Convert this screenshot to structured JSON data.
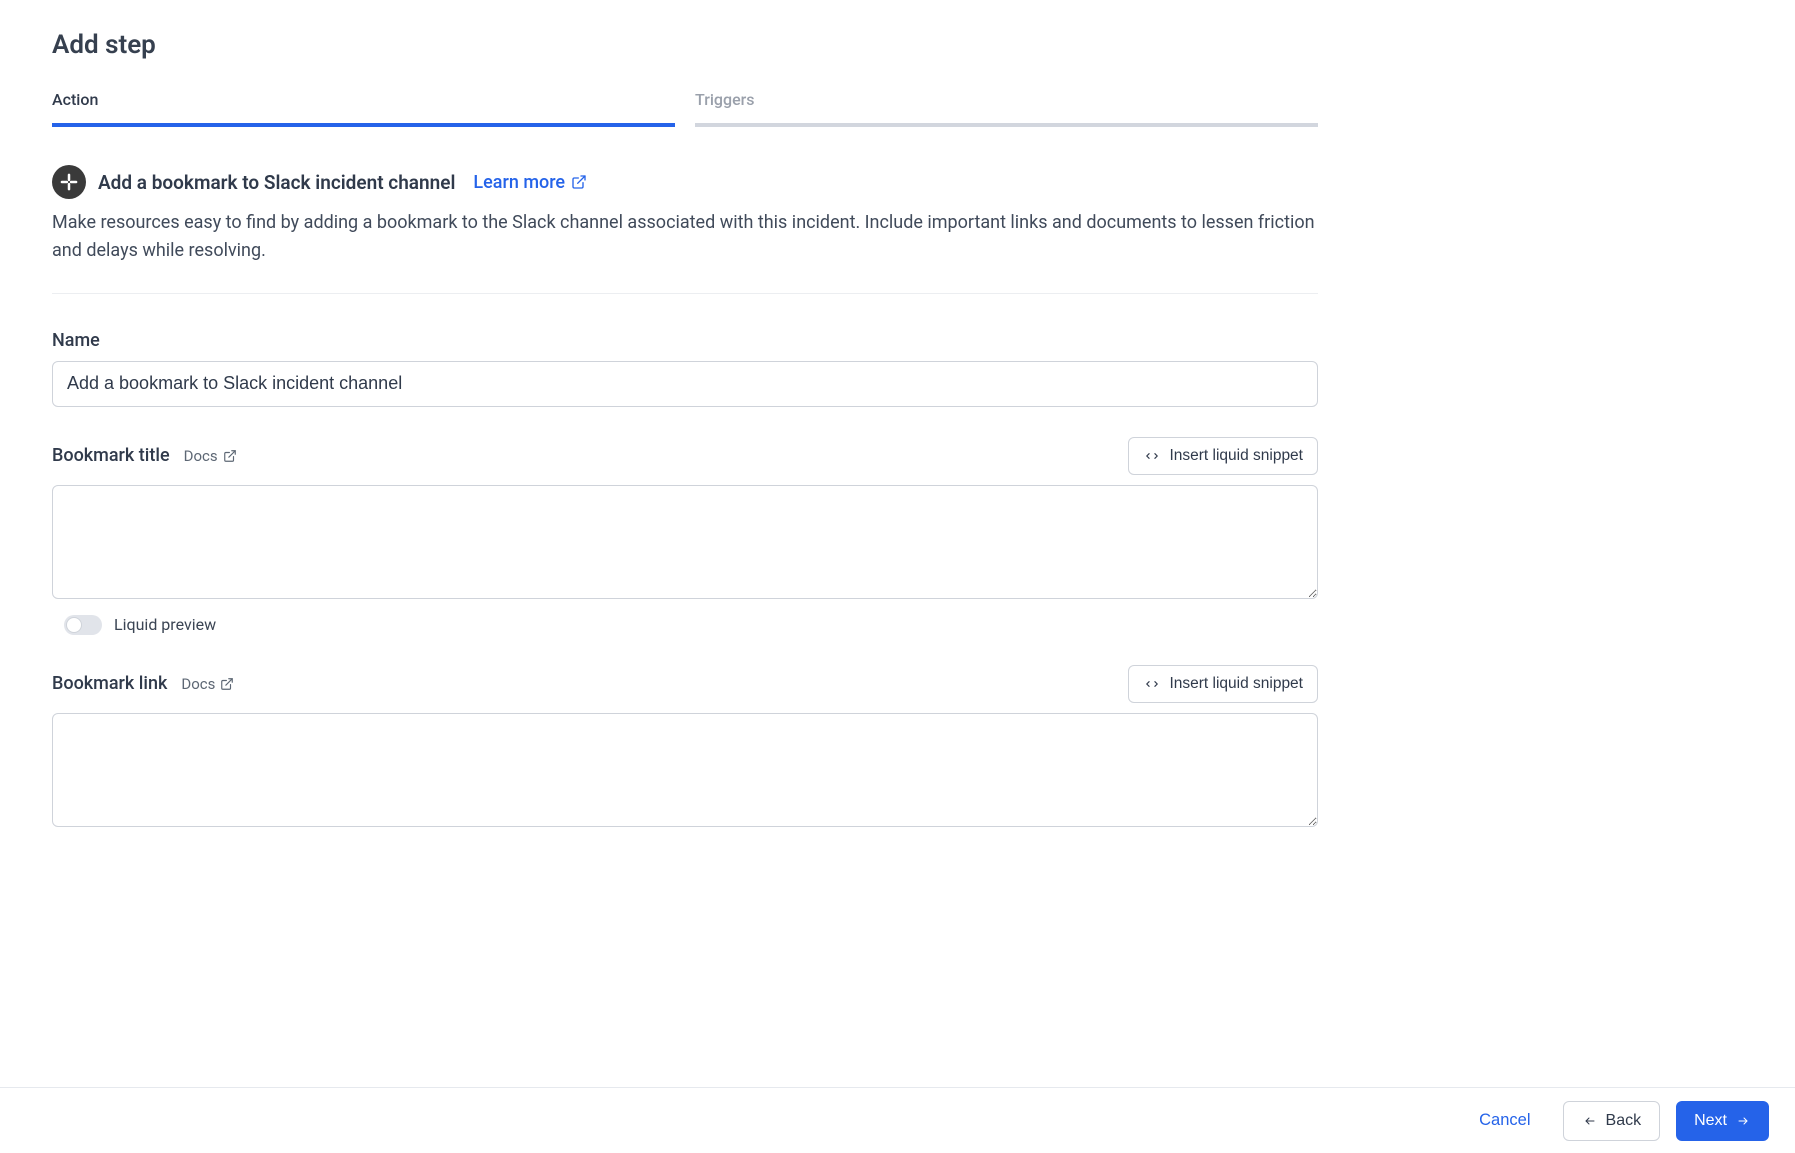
{
  "page": {
    "title": "Add step"
  },
  "tabs": {
    "action": "Action",
    "triggers": "Triggers"
  },
  "actionInfo": {
    "title": "Add a bookmark to Slack incident channel",
    "learnMore": "Learn more",
    "description": "Make resources easy to find by adding a bookmark to the Slack channel associated with this incident. Include important links and documents to lessen friction and delays while resolving."
  },
  "fields": {
    "name": {
      "label": "Name",
      "value": "Add a bookmark to Slack incident channel"
    },
    "bookmarkTitle": {
      "label": "Bookmark title",
      "docs": "Docs",
      "snippet": "Insert liquid snippet",
      "value": "",
      "liquidPreview": "Liquid preview"
    },
    "bookmarkLink": {
      "label": "Bookmark link",
      "docs": "Docs",
      "snippet": "Insert liquid snippet",
      "value": ""
    }
  },
  "footer": {
    "cancel": "Cancel",
    "back": "Back",
    "next": "Next"
  }
}
